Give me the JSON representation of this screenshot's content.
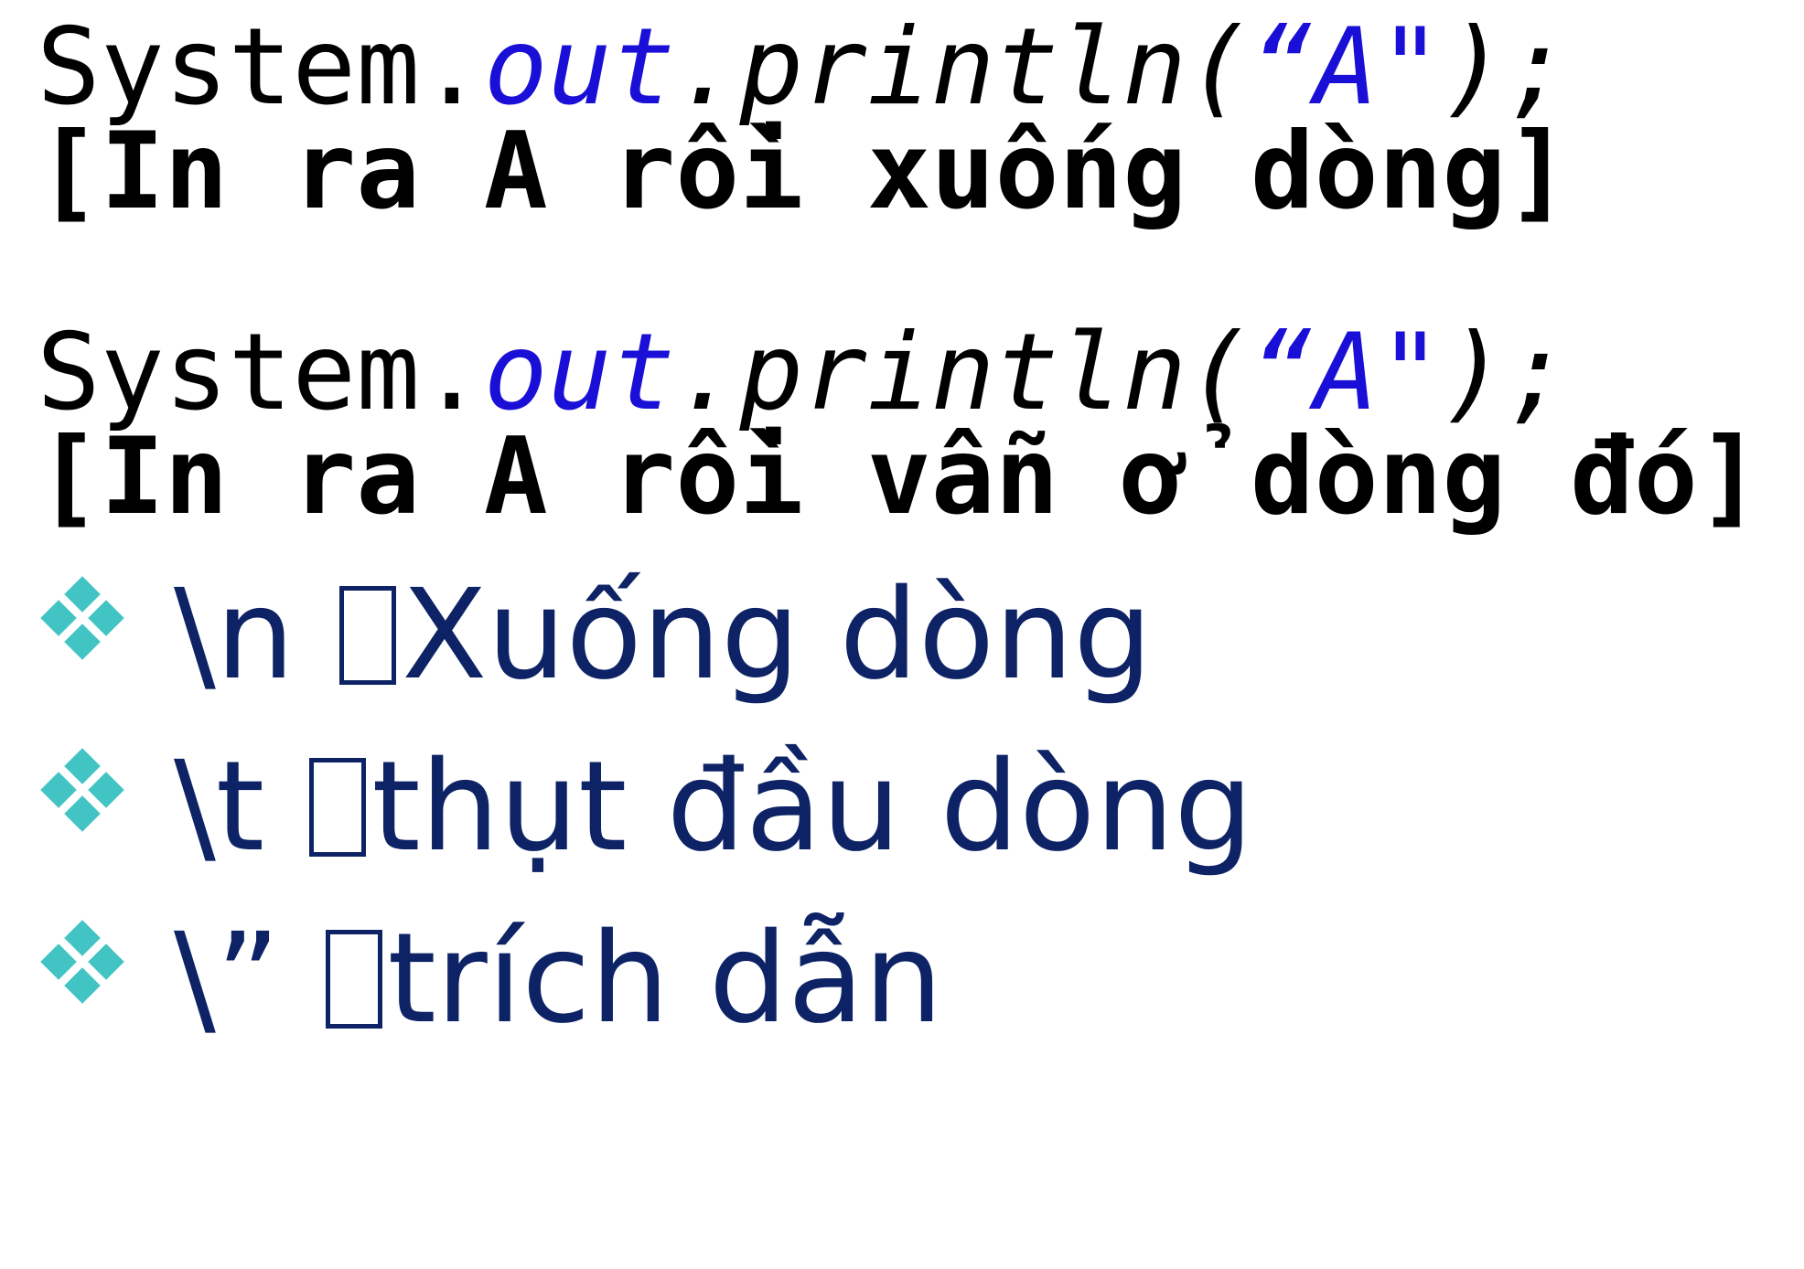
{
  "code_block_1": {
    "code": {
      "prefix": "System.",
      "field": "out",
      "method": ".println(",
      "string": "“A\"",
      "suffix": ");"
    },
    "comment": "[In ra A rồi xuống dòng]"
  },
  "code_block_2": {
    "code": {
      "prefix": "System.",
      "field": "out",
      "method": ".println(",
      "string": "“A\"",
      "suffix": ");"
    },
    "comment": "[In ra A rồi vẫn ở dòng đó]"
  },
  "escapes": [
    {
      "seq": "\\n ",
      "desc": "Xuống dòng"
    },
    {
      "seq": "\\t ",
      "desc": "thụt đầu dòng"
    },
    {
      "seq": "\\” ",
      "desc": "trích dẫn"
    }
  ],
  "colors": {
    "keyword": "#1a0fd6",
    "bullet_text": "#0e2366",
    "bullet_icon": "#43c4c4"
  }
}
